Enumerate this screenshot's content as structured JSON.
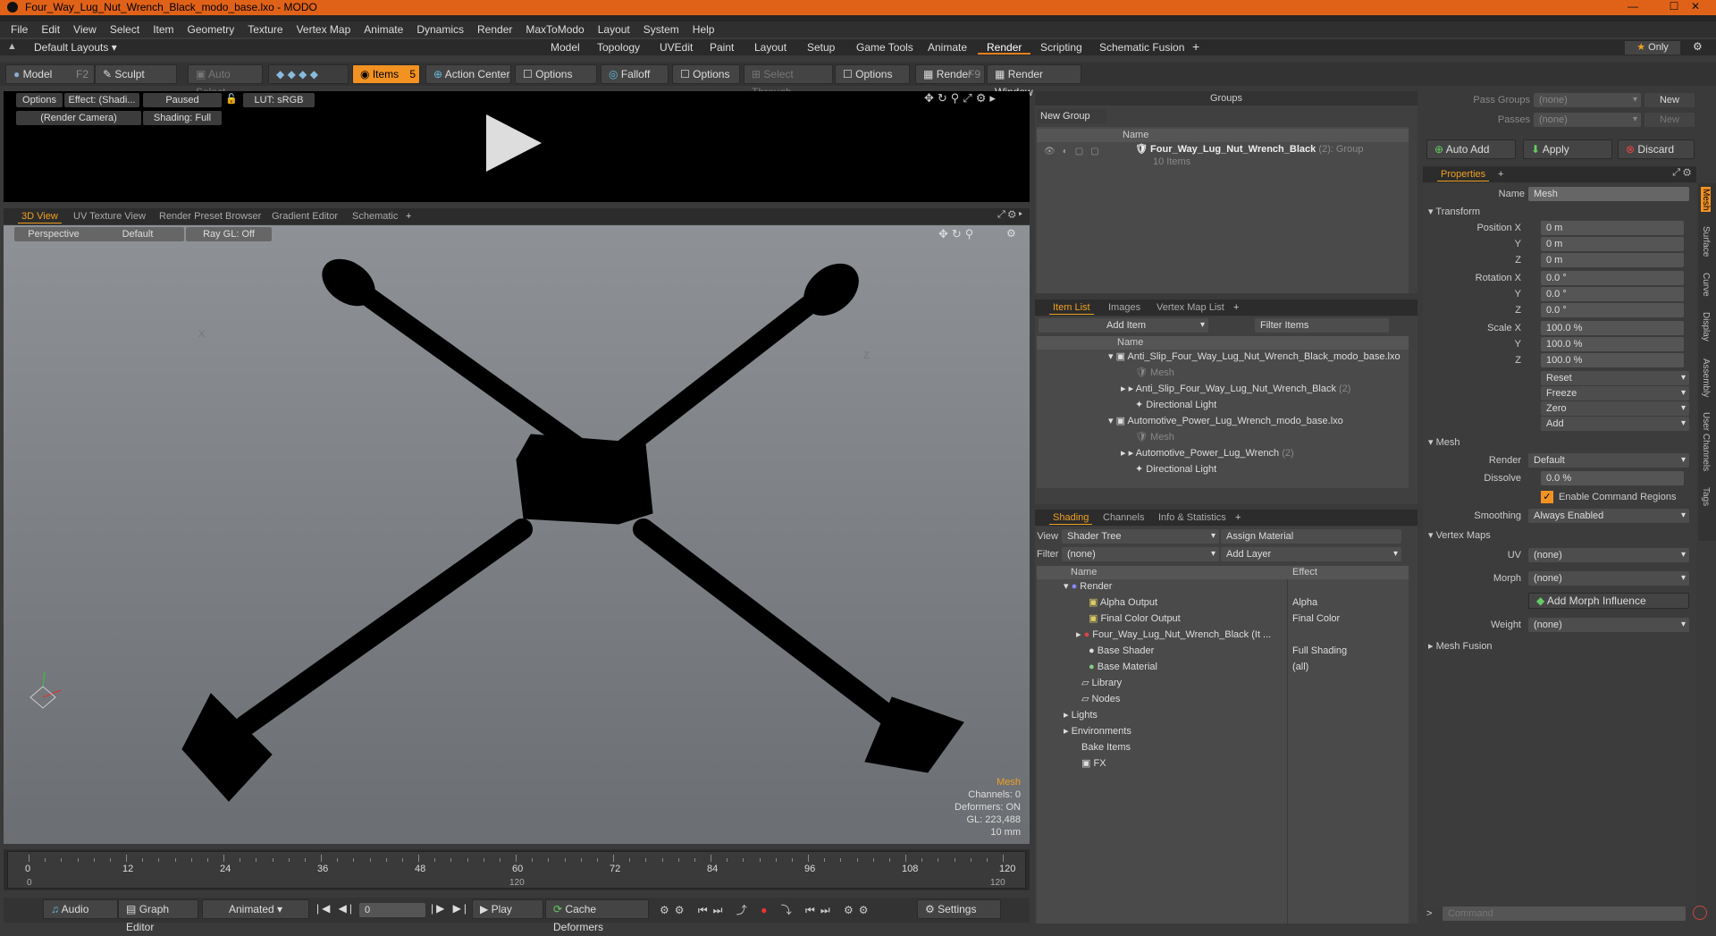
{
  "window": {
    "title": "Four_Way_Lug_Nut_Wrench_Black_modo_base.lxo - MODO"
  },
  "menu": [
    "File",
    "Edit",
    "View",
    "Select",
    "Item",
    "Geometry",
    "Texture",
    "Vertex Map",
    "Animate",
    "Dynamics",
    "Render",
    "MaxToModo",
    "Layout",
    "System",
    "Help"
  ],
  "layouts": {
    "selector": "Default Layouts",
    "tabs": [
      "Model",
      "Topology",
      "UVEdit",
      "Paint",
      "Layout",
      "Setup",
      "Game Tools",
      "Animate",
      "Render",
      "Scripting",
      "Schematic Fusion"
    ],
    "active": "Render",
    "only": "Only"
  },
  "toolbar": {
    "model": "Model",
    "model_key": "F2",
    "sculpt": "Sculpt",
    "auto_select": "Auto Select",
    "items": "Items",
    "items_key": "5",
    "action_center": "Action Center",
    "options1": "Options",
    "falloff": "Falloff",
    "options2": "Options",
    "select_through": "Select Through",
    "options3": "Options",
    "render": "Render",
    "render_key": "F9",
    "render_window": "Render Window"
  },
  "preview": {
    "options": "Options",
    "effect": "Effect: (Shadi...",
    "paused": "Paused",
    "lut": "LUT: sRGB",
    "camera": "(Render Camera)",
    "shading": "Shading: Full"
  },
  "viewport": {
    "tabs": [
      "3D View",
      "UV Texture View",
      "Render Preset Browser",
      "Gradient Editor",
      "Schematic"
    ],
    "perspective": "Perspective",
    "default": "Default",
    "raygl": "Ray GL: Off",
    "axis_x": "X",
    "axis_z": "Z",
    "stats": {
      "item": "Mesh",
      "channels": "Channels: 0",
      "deformers": "Deformers: ON",
      "gl": "GL: 223,488",
      "scale": "10 mm"
    }
  },
  "timeline": {
    "ticks": [
      "0",
      "12",
      "24",
      "36",
      "48",
      "60",
      "72",
      "84",
      "96",
      "108",
      "120"
    ],
    "sub_start": "0",
    "sub_mid": "120",
    "sub_end": "120"
  },
  "transport": {
    "audio": "Audio",
    "graph_editor": "Graph Editor",
    "animated": "Animated",
    "frame": "0",
    "play": "Play",
    "cache": "Cache Deformers",
    "settings": "Settings"
  },
  "groups": {
    "title": "Groups",
    "new_group": "New Group",
    "col_name": "Name",
    "item": "Four_Way_Lug_Nut_Wrench_Black",
    "item_count": "(2)",
    "item_type": ": Group",
    "item_sub": "10 Items"
  },
  "itemlist": {
    "tabs": [
      "Item List",
      "Images",
      "Vertex Map List"
    ],
    "add_item": "Add Item",
    "filter": "Filter Items",
    "col_name": "Name",
    "rows": [
      "Anti_Slip_Four_Way_Lug_Nut_Wrench_Black_modo_base.lxo",
      "Mesh",
      "Anti_Slip_Four_Way_Lug_Nut_Wrench_Black",
      "Directional Light",
      "Automotive_Power_Lug_Wrench_modo_base.lxo",
      "Mesh",
      "Automotive_Power_Lug_Wrench",
      "Directional Light"
    ],
    "count": "(2)"
  },
  "shading": {
    "tabs": [
      "Shading",
      "Channels",
      "Info & Statistics"
    ],
    "view_label": "View",
    "view": "Shader Tree",
    "assign": "Assign Material",
    "filter_label": "Filter",
    "filter": "(none)",
    "add_layer": "Add Layer",
    "col_name": "Name",
    "col_effect": "Effect",
    "rows": [
      {
        "n": "Render",
        "e": ""
      },
      {
        "n": "Alpha Output",
        "e": "Alpha"
      },
      {
        "n": "Final Color Output",
        "e": "Final Color"
      },
      {
        "n": "Four_Way_Lug_Nut_Wrench_Black (It ...",
        "e": ""
      },
      {
        "n": "Base Shader",
        "e": "Full Shading"
      },
      {
        "n": "Base Material",
        "e": "(all)"
      },
      {
        "n": "Library",
        "e": ""
      },
      {
        "n": "Nodes",
        "e": ""
      },
      {
        "n": "Lights",
        "e": ""
      },
      {
        "n": "Environments",
        "e": ""
      },
      {
        "n": "Bake Items",
        "e": ""
      },
      {
        "n": "FX",
        "e": ""
      }
    ]
  },
  "passes": {
    "pass_groups": "Pass Groups",
    "passes": "Passes",
    "none": "(none)",
    "new": "New",
    "auto_add": "Auto Add",
    "apply": "Apply",
    "discard": "Discard"
  },
  "properties": {
    "tab": "Properties",
    "name_label": "Name",
    "name": "Mesh",
    "transform": "Transform",
    "pos_label": "Position X",
    "y": "Y",
    "z": "Z",
    "pos": [
      "0 m",
      "0 m",
      "0 m"
    ],
    "rot_label": "Rotation X",
    "rot": [
      "0.0 °",
      "0.0 °",
      "0.0 °"
    ],
    "scale_label": "Scale X",
    "scale": [
      "100.0 %",
      "100.0 %",
      "100.0 %"
    ],
    "actions": [
      "Reset",
      "Freeze",
      "Zero",
      "Add"
    ],
    "mesh": "Mesh",
    "render_label": "Render",
    "render": "Default",
    "dissolve_label": "Dissolve",
    "dissolve": "0.0 %",
    "ecr": "Enable Command Regions",
    "smoothing_label": "Smoothing",
    "smoothing": "Always Enabled",
    "vertex_maps": "Vertex Maps",
    "uv_label": "UV",
    "uv": "(none)",
    "morph_label": "Morph",
    "morph": "(none)",
    "add_morph": "Add Morph Influence",
    "weight_label": "Weight",
    "weight": "(none)",
    "mesh_fusion": "Mesh Fusion",
    "side_tabs": [
      "Mesh",
      "Surface",
      "Curve",
      "Display",
      "Assembly",
      "User Channels",
      "Tags"
    ]
  },
  "command": {
    "placeholder": "Command"
  }
}
